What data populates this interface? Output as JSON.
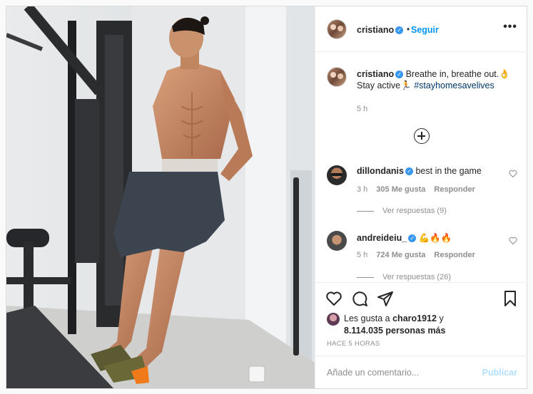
{
  "post": {
    "username": "cristiano",
    "follow_separator": "•",
    "follow_label": "Seguir",
    "more_icon": "more-horizontal-icon",
    "caption_text_line1": "Breathe in, breathe out.👌",
    "caption_text_line2": "Stay active🏃",
    "caption_hashtag": "#stayhomesavelives",
    "caption_age": "5 h"
  },
  "comments": [
    {
      "username": "dillondanis",
      "text": "best in the game",
      "age": "3 h",
      "likes": "305 Me gusta",
      "reply": "Responder",
      "replies": "Ver respuestas (9)"
    },
    {
      "username": "andreideiu_",
      "text": "💪🔥🔥",
      "age": "5 h",
      "likes": "724 Me gusta",
      "reply": "Responder",
      "replies": "Ver respuestas (26)"
    }
  ],
  "likes_summary": {
    "prefix": "Les gusta a ",
    "user": "charo1912",
    "mid": " y",
    "count": "8.114.035 personas más"
  },
  "timestamp": "HACE 5 HORAS",
  "comment_box": {
    "placeholder": "Añade un comentario...",
    "publish": "Publicar"
  },
  "colors": {
    "link": "#0095f6",
    "verified": "#3897f0",
    "muted": "#8e8e8e",
    "border": "#dbdbdb"
  }
}
